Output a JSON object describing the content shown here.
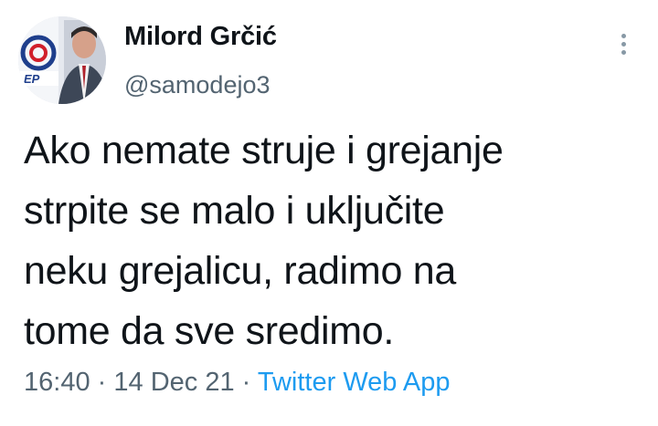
{
  "author": {
    "display_name": "Milord Grčić",
    "handle": "@samodejo3",
    "avatar_logo_text": "EPS"
  },
  "tweet": {
    "lines": [
      "Ako nemate struje i grejanje",
      "strpite se malo i uključite",
      "neku grejalicu, radimo na",
      "tome da sve sredimo."
    ]
  },
  "meta": {
    "time": "16:40",
    "separator": "·",
    "date": "14 Dec 21",
    "source": "Twitter Web App"
  },
  "colors": {
    "text": "#0f1419",
    "secondary": "#536471",
    "link": "#1d9bf0"
  },
  "icons": {
    "more": "more-vertical-icon"
  }
}
